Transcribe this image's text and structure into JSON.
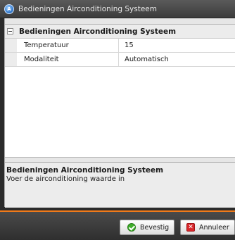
{
  "window": {
    "title": "Bedieningen Airconditioning Systeem",
    "icon": "app-logo-icon"
  },
  "grid": {
    "category": "Bedieningen Airconditioning Systeem",
    "rows": [
      {
        "name": "Temperatuur",
        "value": "15"
      },
      {
        "name": "Modaliteit",
        "value": "Automatisch"
      }
    ]
  },
  "description": {
    "title": "Bedieningen Airconditioning Systeem",
    "text": "Voer de airconditioning waarde in"
  },
  "footer": {
    "confirm_label": "Bevestig",
    "cancel_label": "Annuleer"
  },
  "colors": {
    "accent": "#f07a1a",
    "confirm_icon": "#3fae2a",
    "cancel_icon": "#d8262a"
  }
}
